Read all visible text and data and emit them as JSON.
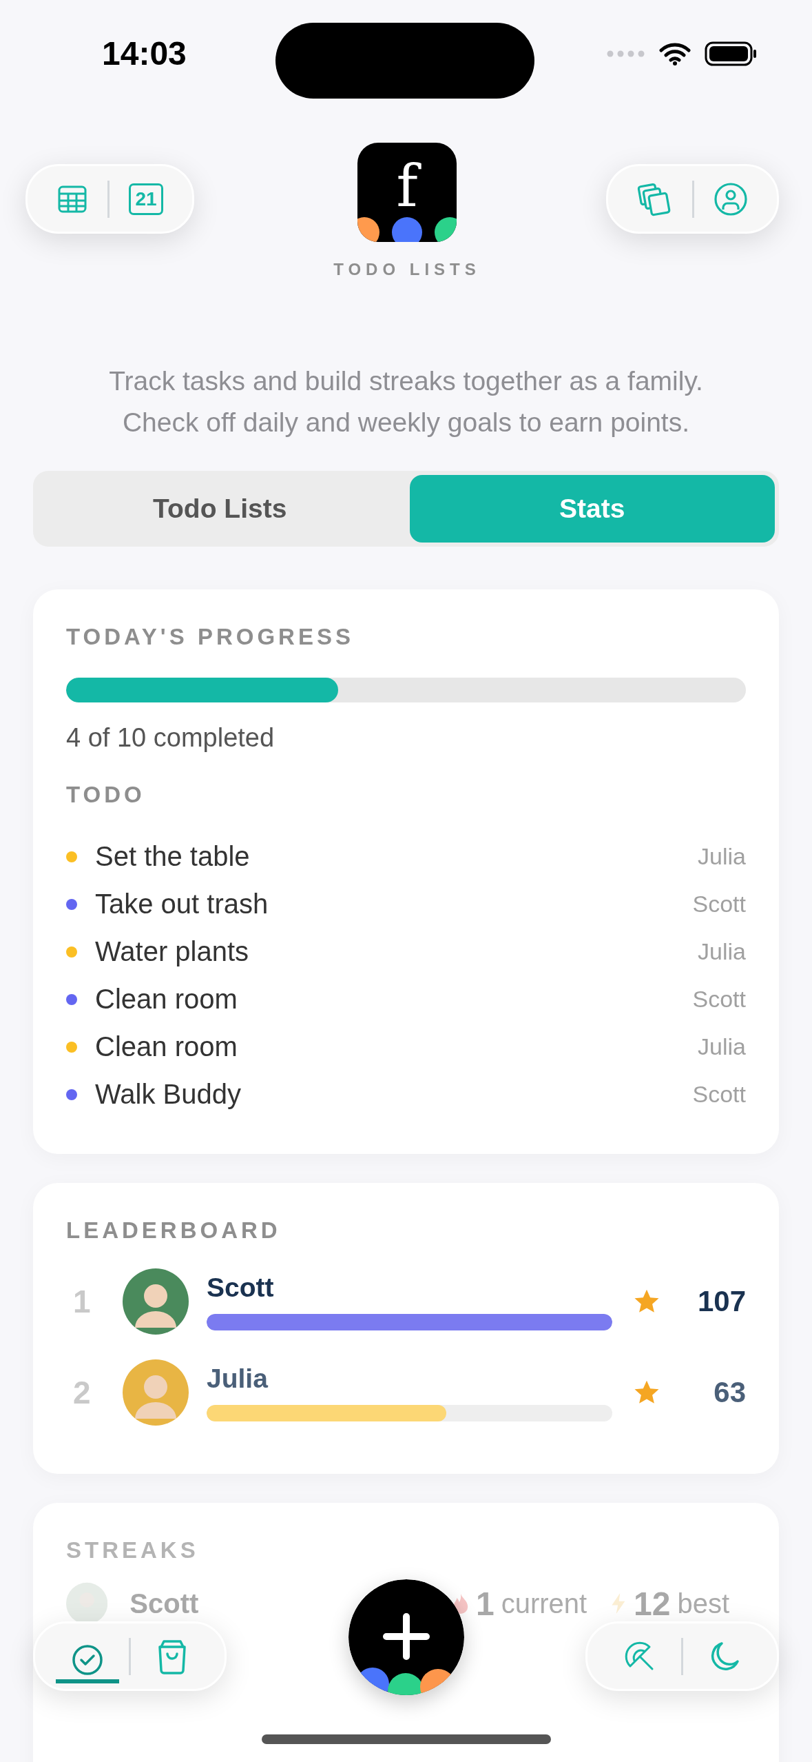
{
  "status_bar": {
    "time": "14:03"
  },
  "header": {
    "calendar_day": "21",
    "logo_letter": "f",
    "app_name": "TODO LISTS"
  },
  "description": "Track tasks and build streaks together as a family. Check off daily and weekly goals to earn points.",
  "tabs": [
    {
      "label": "Todo Lists",
      "selected": false
    },
    {
      "label": "Stats",
      "selected": true
    }
  ],
  "progress": {
    "title": "TODAY'S PROGRESS",
    "level": 0.4,
    "summary": "4 of 10 completed",
    "todo_title": "TODO",
    "items": [
      {
        "task": "Set the table",
        "assignee": "Julia",
        "color": "#fbbf24"
      },
      {
        "task": "Take out trash",
        "assignee": "Scott",
        "color": "#6366f1"
      },
      {
        "task": "Water plants",
        "assignee": "Julia",
        "color": "#fbbf24"
      },
      {
        "task": "Clean room",
        "assignee": "Scott",
        "color": "#6366f1"
      },
      {
        "task": "Clean room",
        "assignee": "Julia",
        "color": "#fbbf24"
      },
      {
        "task": "Walk Buddy",
        "assignee": "Scott",
        "color": "#6366f1"
      }
    ]
  },
  "leaderboard": {
    "title": "LEADERBOARD",
    "rows": [
      {
        "rank": "1",
        "name": "Scott",
        "level": 1.0,
        "color": "#7b7bf0",
        "points": "107"
      },
      {
        "rank": "2",
        "name": "Julia",
        "level": 0.59,
        "color": "#fcd775",
        "points": "63"
      }
    ]
  },
  "streaks": {
    "title": "STREAKS",
    "rows": [
      {
        "name": "Scott",
        "current": "1",
        "current_label": "current",
        "best": "12",
        "best_label": "best"
      }
    ]
  },
  "bottom_nav": {
    "left": [
      {
        "kind": "check",
        "selected": true
      },
      {
        "kind": "bag",
        "selected": false
      }
    ],
    "right": [
      {
        "kind": "umbrella"
      },
      {
        "kind": "moon"
      }
    ]
  }
}
